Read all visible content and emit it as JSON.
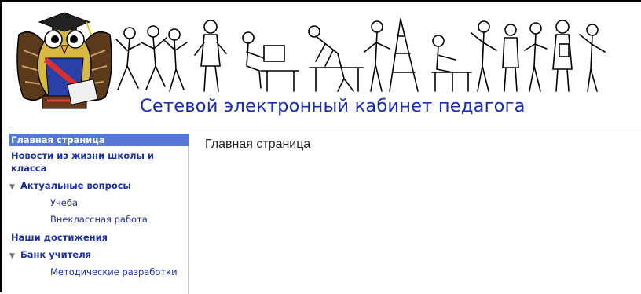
{
  "header": {
    "site_title": "Сетевой электронный кабинет педагога"
  },
  "sidebar": {
    "items": [
      {
        "label": "Главная страница"
      },
      {
        "label": "Новости из жизни школы и"
      },
      {
        "label": "класса"
      },
      {
        "label": "Актуальные вопросы"
      },
      {
        "label": "Учеба"
      },
      {
        "label": "Внеклассная работа"
      },
      {
        "label": "Наши достижения"
      },
      {
        "label": "Банк учителя"
      },
      {
        "label": "Методические разработки"
      }
    ]
  },
  "main": {
    "page_title": "Главная страница"
  },
  "icons": {
    "expand": "triangle-down-icon",
    "logo": "owl-mascot-logo"
  },
  "colors": {
    "title_blue": "#1a2bb0",
    "link_blue": "#1b2fa8",
    "active_bg": "#5578d6"
  }
}
